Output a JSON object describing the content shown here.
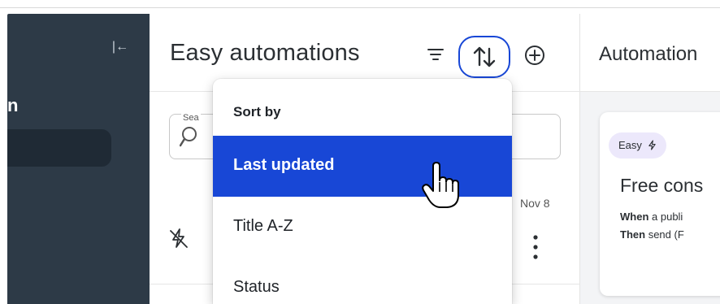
{
  "left_panel": {
    "title_fragment": "n",
    "collapse_glyph": "|←"
  },
  "list_panel": {
    "title": "Easy automations",
    "search": {
      "label_fragment": "Sea"
    },
    "row": {
      "date": "Nov 8"
    }
  },
  "sort_dropdown": {
    "header": "Sort by",
    "options": [
      "Last updated",
      "Title A-Z",
      "Status"
    ],
    "selected": "Last updated"
  },
  "detail_panel": {
    "title": "Automation",
    "card": {
      "badge": "Easy",
      "title": "Free cons",
      "when_label": "When",
      "when_text": "a publi",
      "then_label": "Then",
      "then_text": "send (F"
    }
  },
  "colors": {
    "sidebar_bg": "#2d3a47",
    "accent": "#1847d6",
    "badge_bg": "#ece8fb"
  }
}
